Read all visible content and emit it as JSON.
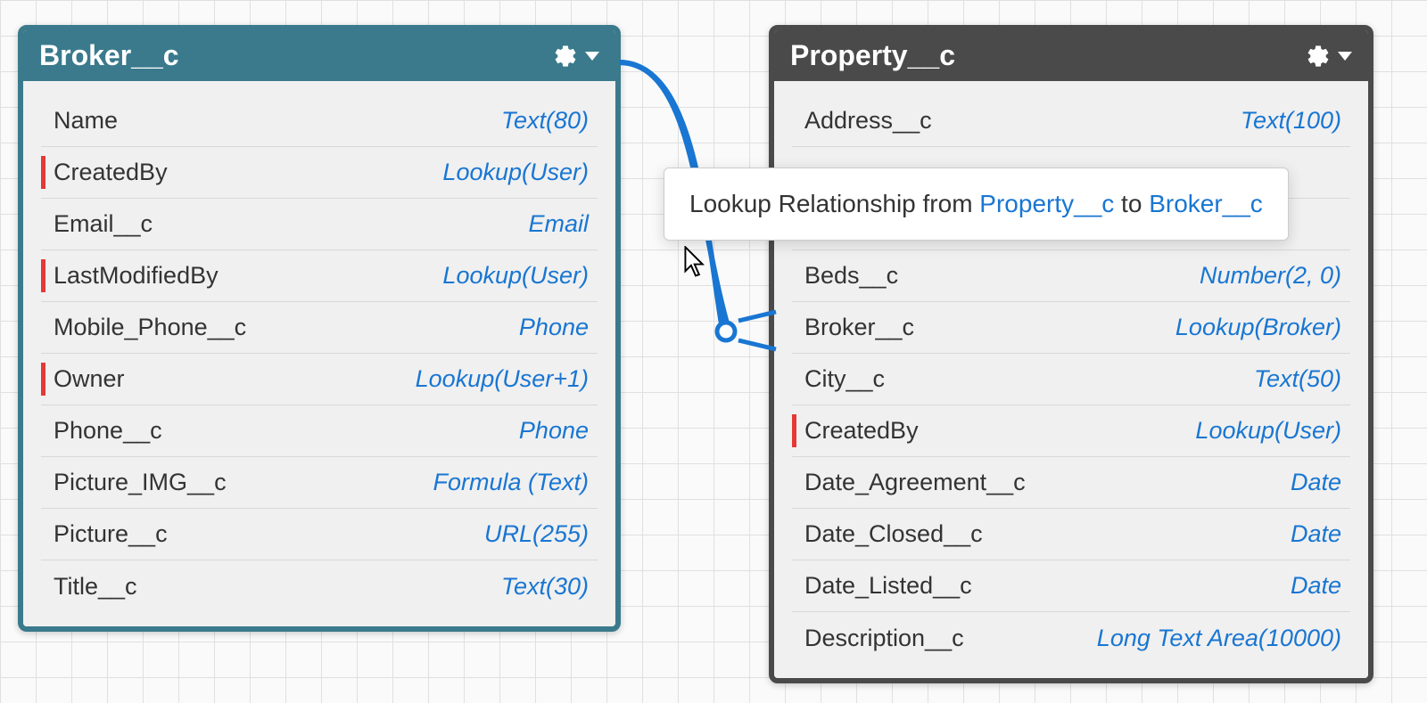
{
  "cards": {
    "broker": {
      "title": "Broker__c",
      "fields": [
        {
          "name": "Name",
          "type": "Text(80)",
          "marker": false
        },
        {
          "name": "CreatedBy",
          "type": "Lookup(User)",
          "marker": true
        },
        {
          "name": "Email__c",
          "type": "Email",
          "marker": false
        },
        {
          "name": "LastModifiedBy",
          "type": "Lookup(User)",
          "marker": true
        },
        {
          "name": "Mobile_Phone__c",
          "type": "Phone",
          "marker": false
        },
        {
          "name": "Owner",
          "type": "Lookup(User+1)",
          "marker": true
        },
        {
          "name": "Phone__c",
          "type": "Phone",
          "marker": false
        },
        {
          "name": "Picture_IMG__c",
          "type": "Formula (Text)",
          "marker": false
        },
        {
          "name": "Picture__c",
          "type": "URL(255)",
          "marker": false
        },
        {
          "name": "Title__c",
          "type": "Text(30)",
          "marker": false
        }
      ]
    },
    "property": {
      "title": "Property__c",
      "fields": [
        {
          "name": "Address__c",
          "type": "Text(100)",
          "marker": false
        },
        {
          "name": "",
          "type": "",
          "marker": false
        },
        {
          "name": "",
          "type": "",
          "marker": false
        },
        {
          "name": "Beds__c",
          "type": "Number(2, 0)",
          "marker": false
        },
        {
          "name": "Broker__c",
          "type": "Lookup(Broker)",
          "marker": false
        },
        {
          "name": "City__c",
          "type": "Text(50)",
          "marker": false
        },
        {
          "name": "CreatedBy",
          "type": "Lookup(User)",
          "marker": true
        },
        {
          "name": "Date_Agreement__c",
          "type": "Date",
          "marker": false
        },
        {
          "name": "Date_Closed__c",
          "type": "Date",
          "marker": false
        },
        {
          "name": "Date_Listed__c",
          "type": "Date",
          "marker": false
        },
        {
          "name": "Description__c",
          "type": "Long Text Area(10000)",
          "marker": false
        }
      ]
    }
  },
  "tooltip": {
    "prefix": "Lookup Relationship from ",
    "from": "Property__c",
    "middle": " to ",
    "to": "Broker__c"
  }
}
